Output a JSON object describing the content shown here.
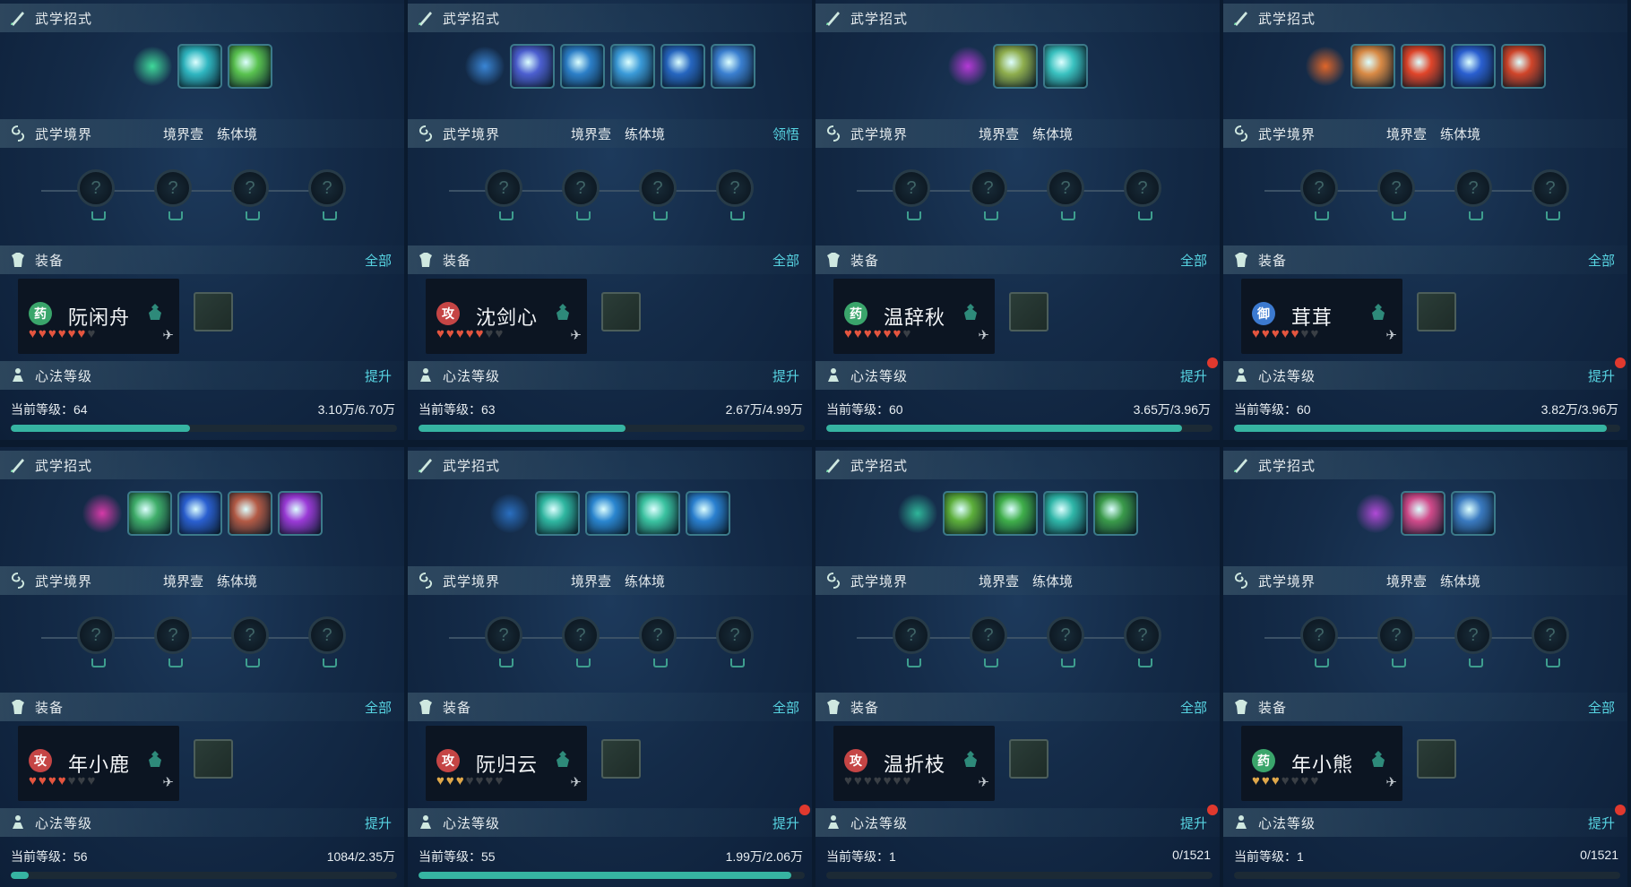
{
  "labels": {
    "skills": "武学招式",
    "realm": "武学境界",
    "equipment": "装备",
    "mentality": "心法等级",
    "all_link": "全部",
    "upgrade_link": "提升",
    "comprehend_link": "领悟",
    "realm_level": "境界壹",
    "realm_stage": "练体境"
  },
  "panels": [
    {
      "name": "阮闲舟",
      "type_badge": "药",
      "type_color": "#3aa56b",
      "hearts_filled": 6,
      "hearts_total": 7,
      "heart_style": "red",
      "level": "当前等级：64",
      "exp": "3.10万/6.70万",
      "exp_fraction": 0.463,
      "upgrade_dot": false,
      "show_comprehend": false,
      "skill_colors": [
        "#3fd99a",
        "#2fb6c0",
        "#59c24f"
      ]
    },
    {
      "name": "沈剑心",
      "type_badge": "攻",
      "type_color": "#c54545",
      "hearts_filled": 5,
      "hearts_total": 7,
      "heart_style": "red",
      "level": "当前等级：63",
      "exp": "2.67万/4.99万",
      "exp_fraction": 0.535,
      "upgrade_dot": false,
      "show_comprehend": true,
      "skill_colors": [
        "#3a86d6",
        "#4c5fd0",
        "#2c7fc8",
        "#3a9ad8",
        "#2666c0",
        "#3a7fd0"
      ]
    },
    {
      "name": "温辞秋",
      "type_badge": "药",
      "type_color": "#3aa56b",
      "hearts_filled": 6,
      "hearts_total": 7,
      "heart_style": "red",
      "level": "当前等级：60",
      "exp": "3.65万/3.96万",
      "exp_fraction": 0.92,
      "upgrade_dot": true,
      "show_comprehend": false,
      "skill_colors": [
        "#b43ad6",
        "#8fae4e",
        "#3ac2c0"
      ]
    },
    {
      "name": "茸茸",
      "type_badge": "御",
      "type_color": "#3c7ad0",
      "hearts_filled": 5,
      "hearts_total": 7,
      "heart_style": "red",
      "level": "当前等级：60",
      "exp": "3.82万/3.96万",
      "exp_fraction": 0.965,
      "upgrade_dot": true,
      "show_comprehend": false,
      "skill_colors": [
        "#e0662a",
        "#d98a45",
        "#e0452a",
        "#2a5fd0",
        "#d0452a"
      ]
    },
    {
      "name": "年小鹿",
      "type_badge": "攻",
      "type_color": "#c54545",
      "hearts_filled": 4,
      "hearts_total": 7,
      "heart_style": "red",
      "level": "当前等级：56",
      "exp": "1084/2.35万",
      "exp_fraction": 0.046,
      "upgrade_dot": false,
      "show_comprehend": false,
      "skill_colors": [
        "#d63aa8",
        "#3fae6a",
        "#2a5fd0",
        "#b35a45",
        "#9a3ad6"
      ]
    },
    {
      "name": "阮归云",
      "type_badge": "攻",
      "type_color": "#c54545",
      "hearts_filled": 3,
      "hearts_total": 7,
      "heart_style": "gold",
      "level": "当前等级：55",
      "exp": "1.99万/2.06万",
      "exp_fraction": 0.966,
      "upgrade_dot": true,
      "show_comprehend": false,
      "skill_colors": [
        "#2a6fc0",
        "#2fb6a0",
        "#2a86d0",
        "#3ac2a0",
        "#2a80d0"
      ]
    },
    {
      "name": "温折枝",
      "type_badge": "攻",
      "type_color": "#c54545",
      "hearts_filled": 0,
      "hearts_total": 7,
      "heart_style": "red",
      "level": "当前等级：1",
      "exp": "0/1521",
      "exp_fraction": 0.0,
      "upgrade_dot": true,
      "show_comprehend": false,
      "skill_colors": [
        "#2fb69a",
        "#5cae3a",
        "#3fae4a",
        "#2fb6a8",
        "#3a9a4a"
      ]
    },
    {
      "name": "年小熊",
      "type_badge": "药",
      "type_color": "#3aa56b",
      "hearts_filled": 3,
      "hearts_total": 7,
      "heart_style": "gold",
      "level": "当前等级：1",
      "exp": "0/1521",
      "exp_fraction": 0.0,
      "upgrade_dot": true,
      "show_comprehend": false,
      "skill_colors": [
        "#b04ad6",
        "#d04a8a",
        "#3a7ac0"
      ]
    }
  ]
}
